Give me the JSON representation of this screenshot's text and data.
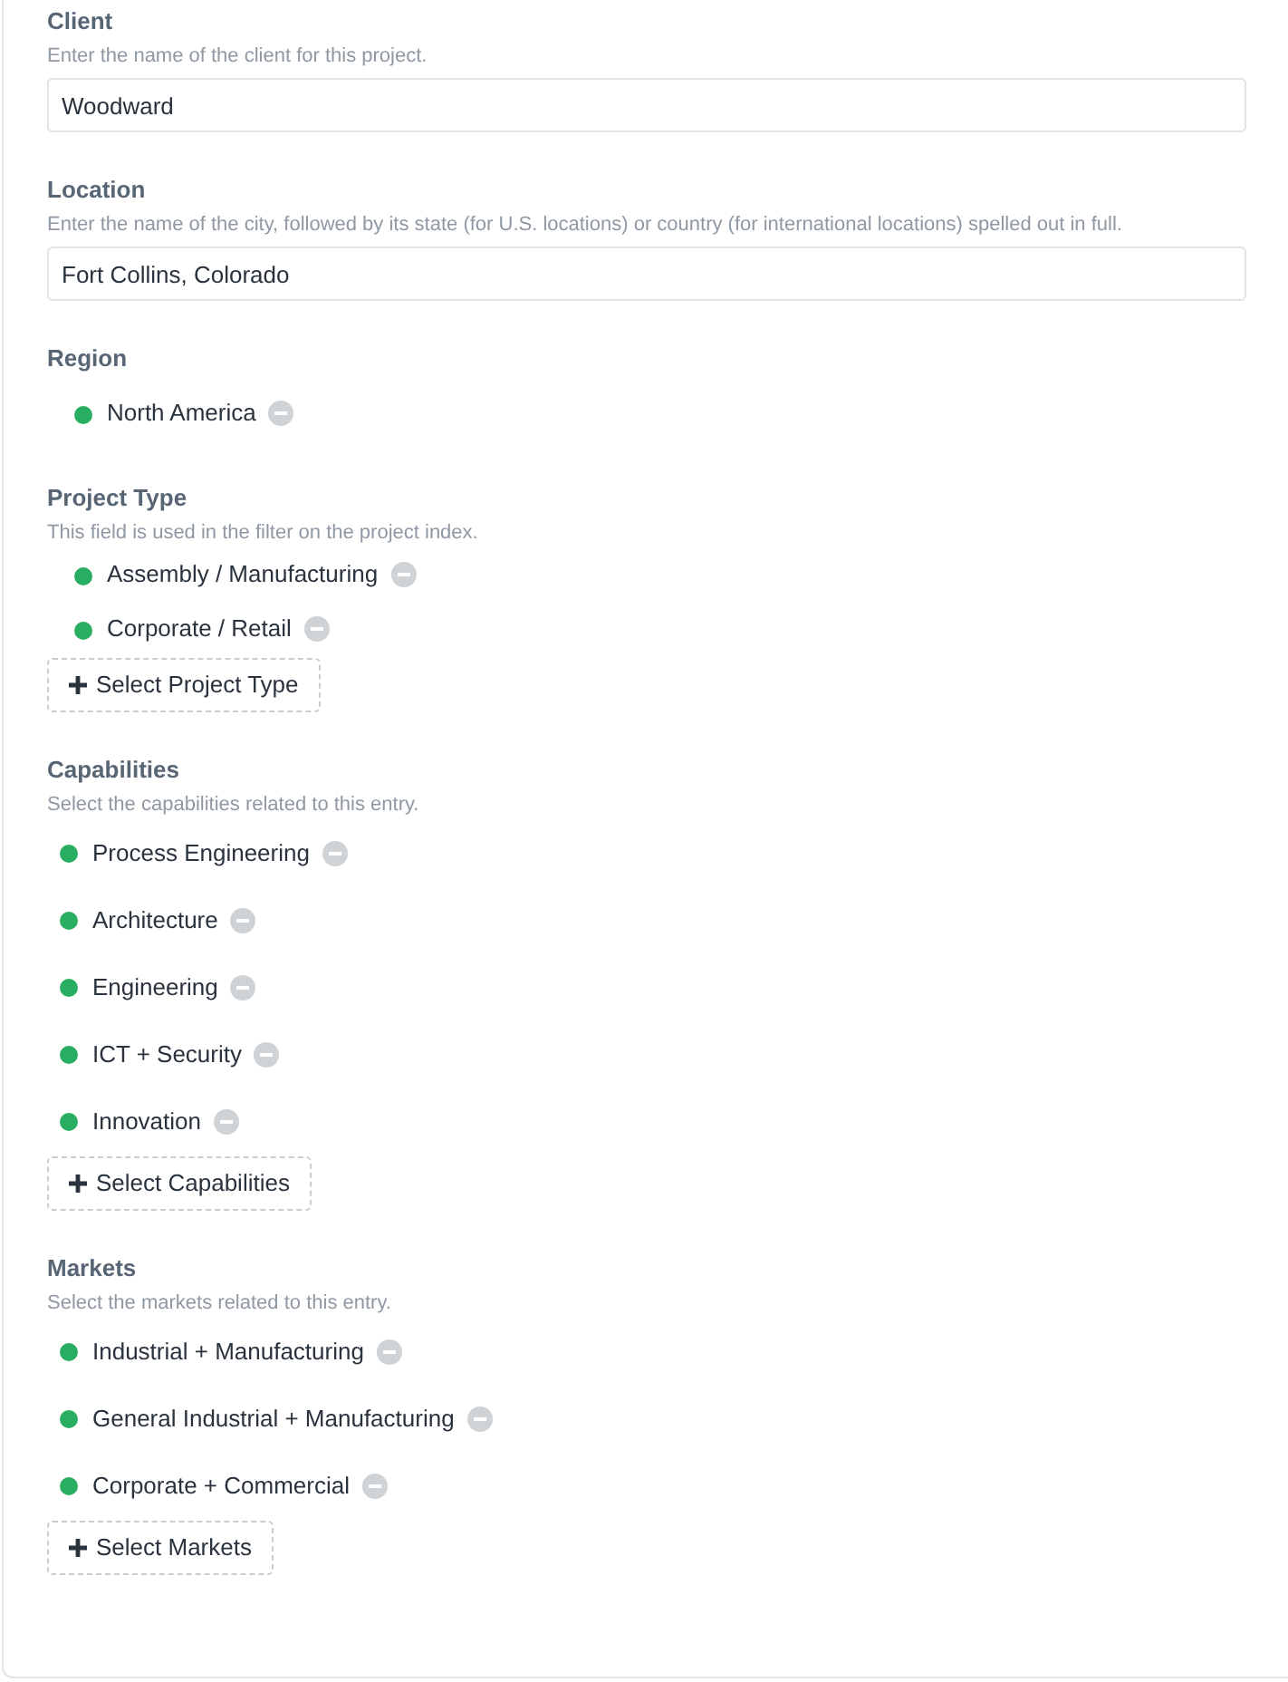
{
  "fields": [
    {
      "kind": "text",
      "label": "Client",
      "instructions": "Enter the name of the client for this project.",
      "value": "Woodward"
    },
    {
      "kind": "text",
      "label": "Location",
      "instructions": "Enter the name of the city, followed by its state (for U.S. locations) or country (for international locations) spelled out in full.",
      "value": "Fort Collins, Colorado"
    },
    {
      "kind": "categories",
      "label": "Region",
      "items": [
        "North America"
      ]
    },
    {
      "kind": "categories",
      "label": "Project Type",
      "instructions": "This field is used in the filter on the project index.",
      "items": [
        "Assembly / Manufacturing",
        "Corporate / Retail"
      ],
      "add_button": "Select Project Type"
    },
    {
      "kind": "entries",
      "label": "Capabilities",
      "instructions": "Select the capabilities related to this entry.",
      "items": [
        "Process Engineering",
        "Architecture",
        "Engineering",
        "ICT + Security",
        "Innovation"
      ],
      "add_button": "Select Capabilities"
    },
    {
      "kind": "entries",
      "label": "Markets",
      "instructions": "Select the markets related to this entry.",
      "items": [
        "Industrial + Manufacturing",
        "General Industrial + Manufacturing",
        "Corporate + Commercial"
      ],
      "add_button": "Select Markets"
    }
  ]
}
